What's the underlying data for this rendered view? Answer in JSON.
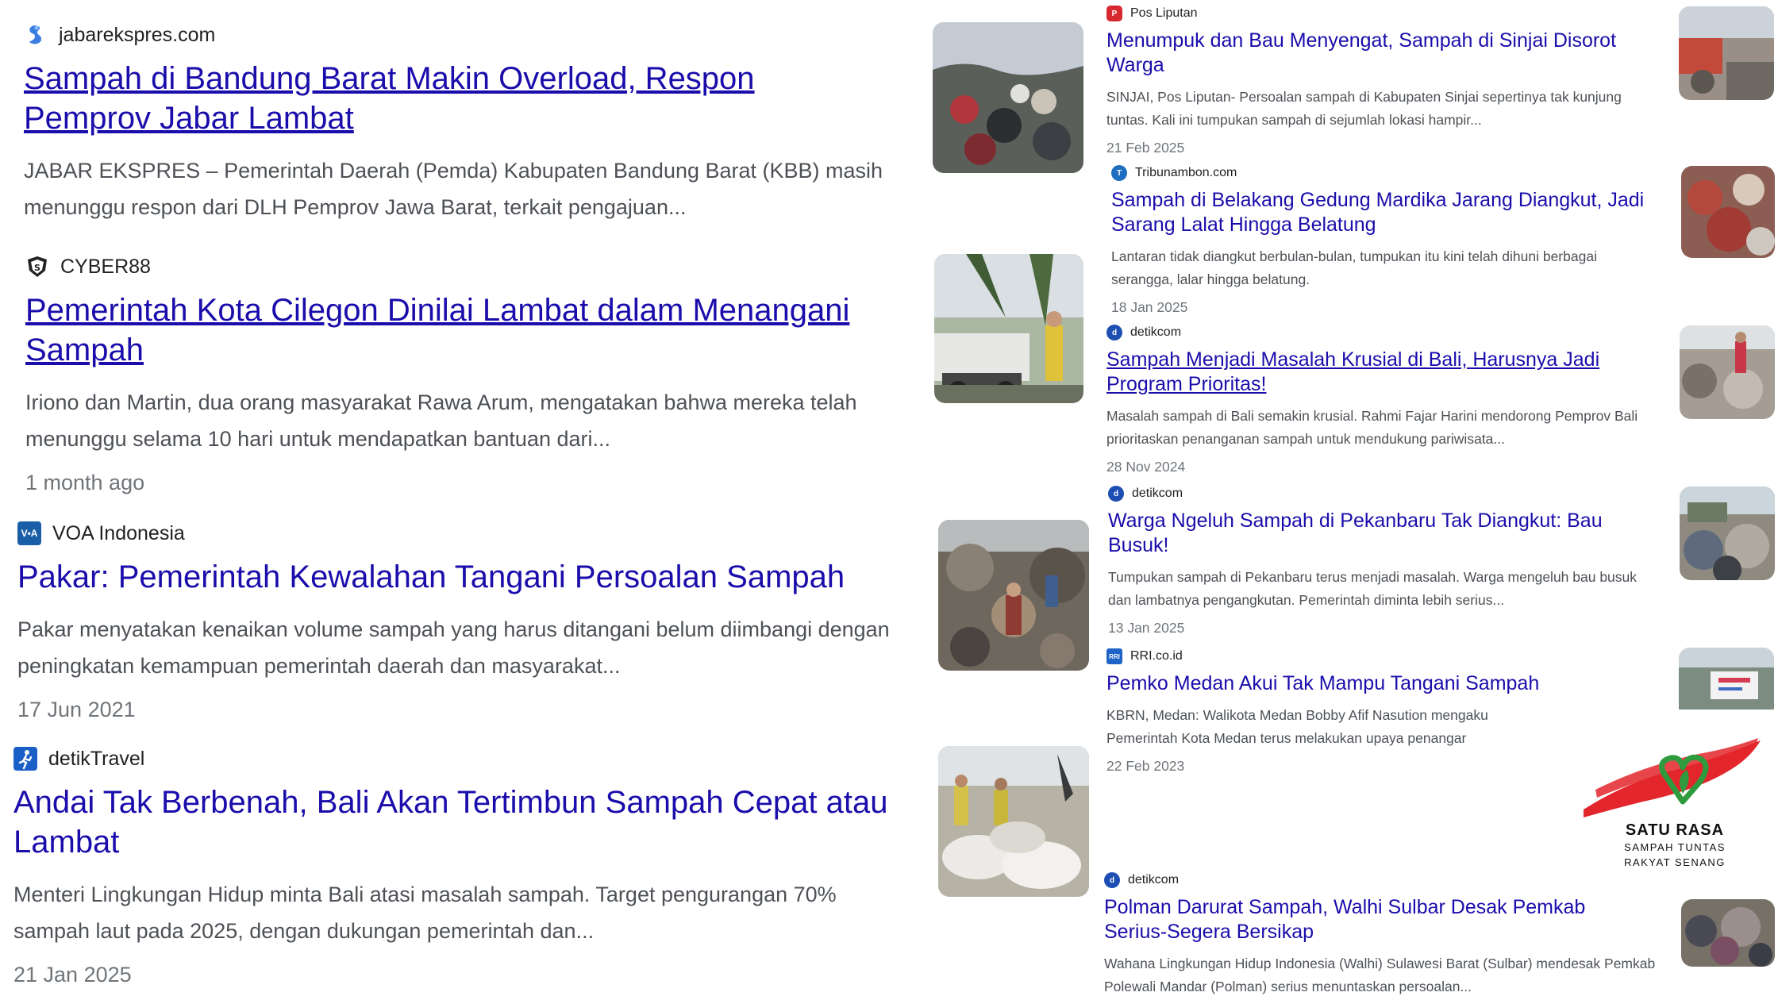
{
  "left_results": [
    {
      "source": "jabarekspres.com",
      "source_icon": "jabarekspres-logo-icon",
      "title": "Sampah di Bandung Barat Makin Overload, Respon Pemprov Jabar Lambat",
      "snippet": "JABAR EKSPRES – Pemerintah Daerah (Pemda) Kabupaten Bandung Barat (KBB) masih menunggu respon dari DLH Pemprov Jawa Barat, terkait pengajuan...",
      "date": ""
    },
    {
      "source": "CYBER88",
      "source_icon": "cyber88-shield-icon",
      "title": "Pemerintah Kota Cilegon Dinilai Lambat dalam Menangani Sampah",
      "snippet": "Iriono dan Martin, dua orang masyarakat Rawa Arum, mengatakan bahwa mereka telah menunggu selama 10 hari untuk mendapatkan bantuan dari...",
      "date": "1 month ago"
    },
    {
      "source": "VOA Indonesia",
      "source_icon": "voa-logo-icon",
      "title": "Pakar: Pemerintah Kewalahan Tangani Persoalan Sampah",
      "snippet": "Pakar menyatakan kenaikan volume sampah yang harus ditangani belum diimbangi dengan peningkatan kemampuan pemerintah daerah dan masyarakat...",
      "date": "17 Jun 2021"
    },
    {
      "source": "detikTravel",
      "source_icon": "detiktravel-logo-icon",
      "title": "Andai Tak Berbenah, Bali Akan Tertimbun Sampah Cepat atau Lambat",
      "snippet": "Menteri Lingkungan Hidup minta Bali atasi masalah sampah. Target pengurangan 70% sampah laut pada 2025, dengan dukungan pemerintah dan...",
      "date": "21 Jan 2025"
    }
  ],
  "right_results": [
    {
      "source": "Pos Liputan",
      "title": "Menumpuk dan Bau Menyengat, Sampah di Sinjai Disorot Warga",
      "snippet": "SINJAI, Pos Liputan- Persoalan sampah di Kabupaten Sinjai sepertinya tak kunjung tuntas. Kali ini tumpukan sampah di sejumlah lokasi hampir...",
      "date": "21 Feb 2025"
    },
    {
      "source": "Tribunambon.com",
      "title": "Sampah di Belakang Gedung Mardika Jarang Diangkut, Jadi Sarang Lalat Hingga Belatung",
      "snippet": "Lantaran tidak diangkut berbulan-bulan, tumpukan itu kini telah dihuni berbagai serangga, lalar hingga belatung.",
      "date": "18 Jan 2025"
    },
    {
      "source": "detikcom",
      "title": "Sampah Menjadi Masalah Krusial di Bali, Harusnya Jadi Program Prioritas!",
      "snippet": "Masalah sampah di Bali semakin krusial. Rahmi Fajar Harini mendorong Pemprov Bali prioritaskan penanganan sampah untuk mendukung pariwisata...",
      "date": "28 Nov 2024"
    },
    {
      "source": "detikcom",
      "title": "Warga Ngeluh Sampah di Pekanbaru Tak Diangkut: Bau Busuk!",
      "snippet": "Tumpukan sampah di Pekanbaru terus menjadi masalah. Warga mengeluh bau busuk dan lambatnya pengangkutan. Pemerintah diminta lebih serius...",
      "date": "13 Jan 2025"
    },
    {
      "source": "RRI.co.id",
      "title": "Pemko Medan Akui Tak Mampu Tangani Sampah",
      "snippet_line1": "KBRN, Medan: Walikota Medan Bobby Afif Nasution mengaku",
      "snippet_line2": "Pemerintah Kota Medan terus melakukan upaya penangar",
      "date": "22 Feb 2023"
    },
    {
      "source": "detikcom",
      "title": "Polman Darurat Sampah, Walhi Sulbar Desak Pemkab Serius-Segera Bersikap",
      "snippet": "Wahana Lingkungan Hidup Indonesia (Walhi) Sulawesi Barat (Sulbar) mendesak Pemkab Polewali Mandar (Polman) serius menuntaskan persoalan...",
      "date": ""
    }
  ],
  "campaign_logo": {
    "line1": "SATU RASA",
    "line2": "SAMPAH TUNTAS",
    "line3": "RAKYAT SENANG",
    "colors": {
      "red": "#e3262b",
      "green": "#2e9b3f"
    }
  },
  "colors": {
    "link": "#1a0dab",
    "snippet": "#4d5156",
    "date": "#70757a"
  }
}
